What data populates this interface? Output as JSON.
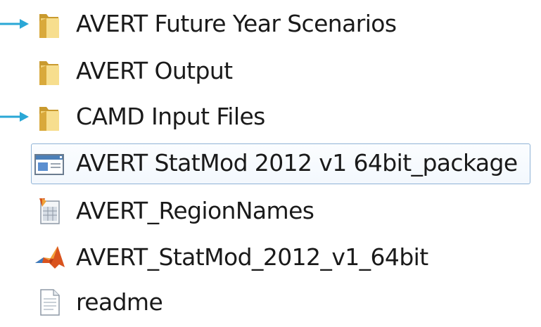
{
  "explorer": {
    "items": [
      {
        "name": "AVERT Future Year Scenarios",
        "icon": "folder-icon",
        "arrow": true,
        "selected": false
      },
      {
        "name": "AVERT Output",
        "icon": "folder-icon",
        "arrow": false,
        "selected": false
      },
      {
        "name": "CAMD Input Files",
        "icon": "folder-icon",
        "arrow": true,
        "selected": false
      },
      {
        "name": "AVERT StatMod 2012 v1 64bit_package",
        "icon": "application-icon",
        "arrow": false,
        "selected": true
      },
      {
        "name": "AVERT_RegionNames",
        "icon": "mat-data-file-icon",
        "arrow": false,
        "selected": false
      },
      {
        "name": "AVERT_StatMod_2012_v1_64bit",
        "icon": "matlab-icon",
        "arrow": false,
        "selected": false
      },
      {
        "name": "readme",
        "icon": "text-file-icon",
        "arrow": false,
        "selected": false
      }
    ]
  },
  "colors": {
    "arrow": "#2aa7d6",
    "folder": "#e9c25e",
    "selection_border": "#8fb3d6"
  }
}
